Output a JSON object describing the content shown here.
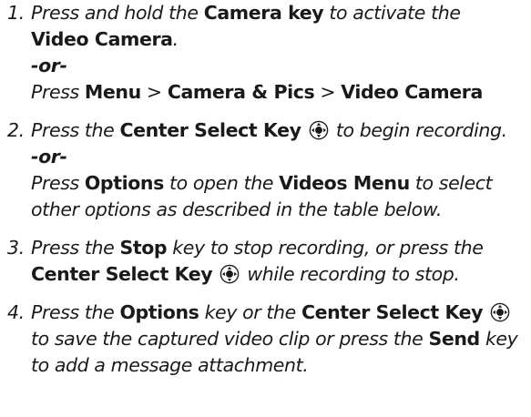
{
  "steps": [
    {
      "number": "1.",
      "lines": [
        [
          {
            "t": "Press and hold the ",
            "s": "i"
          },
          {
            "t": "Camera key",
            "s": "b"
          },
          {
            "t": " to activate the",
            "s": "i"
          }
        ],
        [
          {
            "t": "Video Camera",
            "s": "b"
          },
          {
            "t": ".",
            "s": "i"
          }
        ],
        [
          {
            "t": "-or-",
            "s": "or"
          }
        ],
        [
          {
            "t": "Press ",
            "s": "i"
          },
          {
            "t": "Menu",
            "s": "b"
          },
          {
            "t": " > ",
            "s": "n"
          },
          {
            "t": "Camera & Pics",
            "s": "b"
          },
          {
            "t": " > ",
            "s": "n"
          },
          {
            "t": "Video Camera",
            "s": "b"
          }
        ]
      ]
    },
    {
      "number": "2.",
      "lines": [
        [
          {
            "t": "Press the ",
            "s": "i"
          },
          {
            "t": "Center Select Key",
            "s": "b"
          },
          {
            "t": " ",
            "s": "i"
          },
          {
            "icon": "center-select-key-icon"
          },
          {
            "t": " to begin recording.",
            "s": "i"
          }
        ],
        [
          {
            "t": "-or-",
            "s": "or"
          }
        ],
        [
          {
            "t": "Press ",
            "s": "i"
          },
          {
            "t": "Options",
            "s": "b"
          },
          {
            "t": " to open the ",
            "s": "i"
          },
          {
            "t": "Videos Menu",
            "s": "b"
          },
          {
            "t": " to select",
            "s": "i"
          }
        ],
        [
          {
            "t": "other options as described in the table below.",
            "s": "i"
          }
        ]
      ]
    },
    {
      "number": "3.",
      "lines": [
        [
          {
            "t": "Press the ",
            "s": "i"
          },
          {
            "t": "Stop",
            "s": "b"
          },
          {
            "t": " key to stop recording, or press the",
            "s": "i"
          }
        ],
        [
          {
            "t": "Center Select Key",
            "s": "b"
          },
          {
            "t": " ",
            "s": "i"
          },
          {
            "icon": "center-select-key-icon"
          },
          {
            "t": " while recording to stop.",
            "s": "i"
          }
        ]
      ]
    },
    {
      "number": "4.",
      "lines": [
        [
          {
            "t": "Press the ",
            "s": "i"
          },
          {
            "t": "Options",
            "s": "b"
          },
          {
            "t": " key or the ",
            "s": "i"
          },
          {
            "t": "Center Select Key",
            "s": "b"
          },
          {
            "t": " ",
            "s": "i"
          },
          {
            "icon": "center-select-key-icon"
          }
        ],
        [
          {
            "t": "to save the captured video clip or press the ",
            "s": "i"
          },
          {
            "t": "Send",
            "s": "b"
          },
          {
            "t": " key",
            "s": "i"
          }
        ],
        [
          {
            "t": "to add a message attachment.",
            "s": "i"
          }
        ]
      ]
    }
  ]
}
